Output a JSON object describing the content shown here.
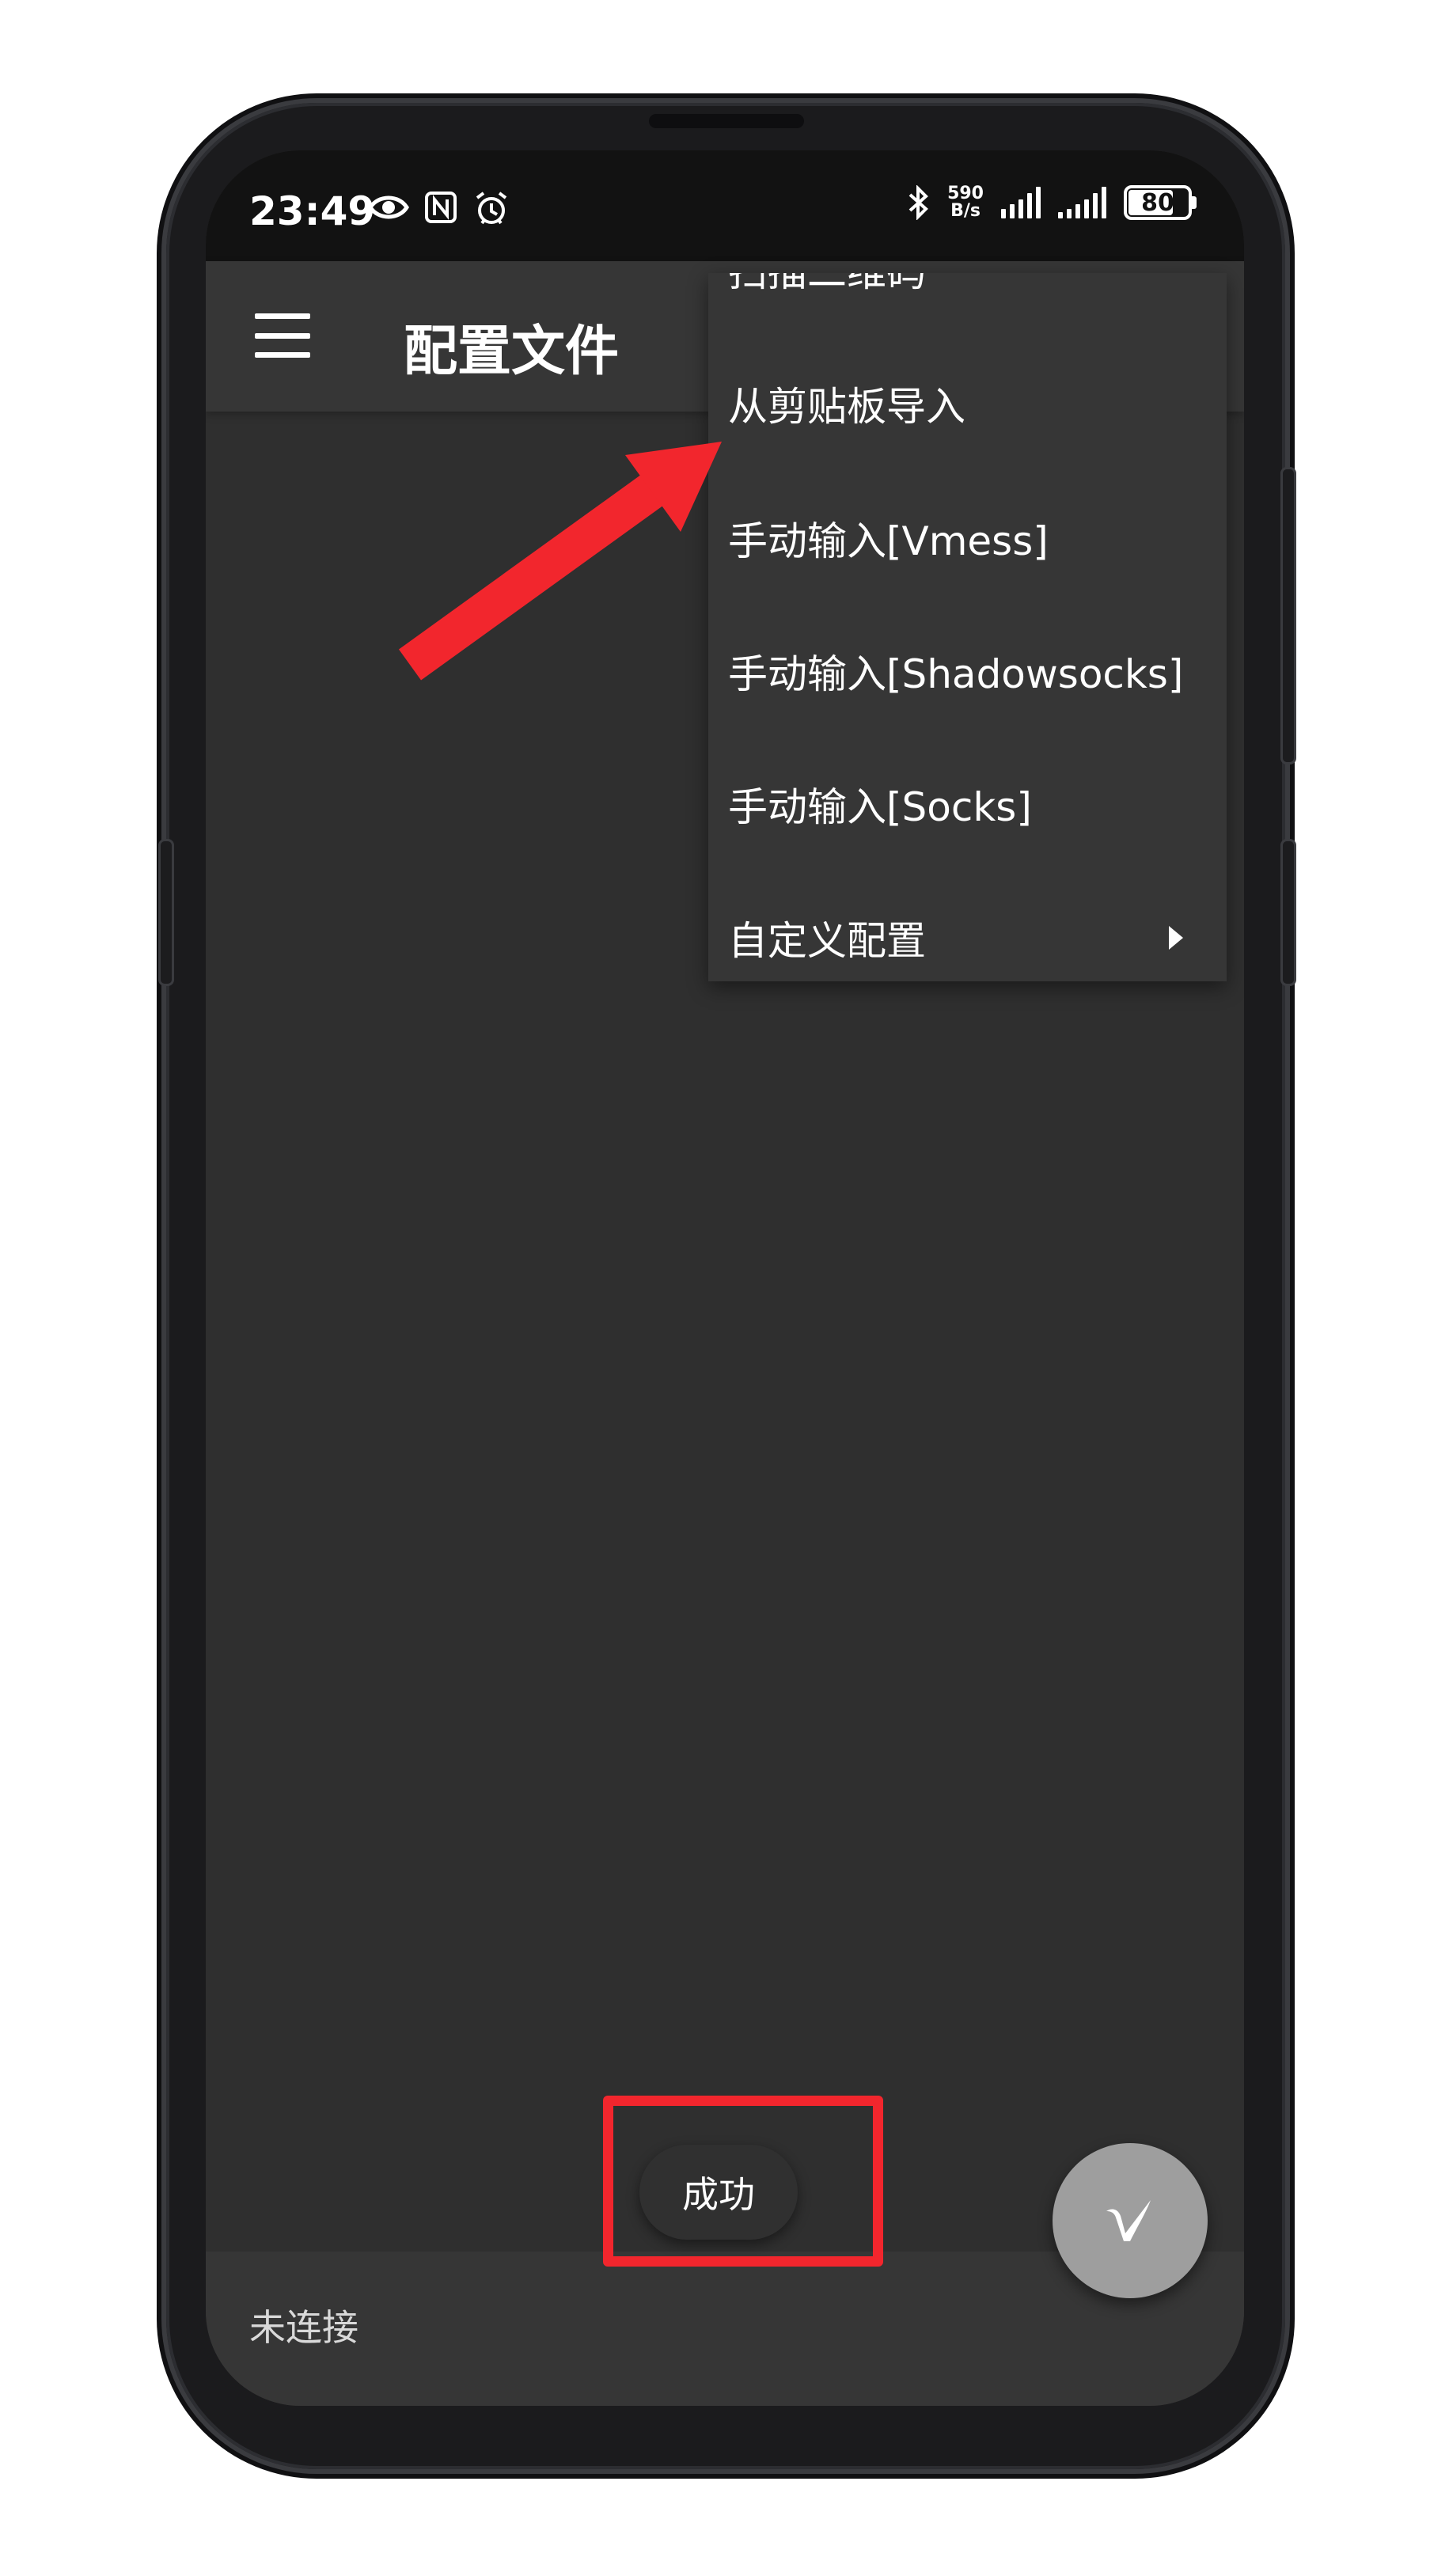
{
  "status_bar": {
    "time": "23:49",
    "net_speed_value": "590",
    "net_speed_unit": "B/s",
    "battery_level": "80",
    "battery_fraction": 0.8
  },
  "toolbar": {
    "title": "配置文件"
  },
  "menu": {
    "items": [
      {
        "label": "扫描二维码"
      },
      {
        "label": "从剪贴板导入"
      },
      {
        "label": "手动输入[Vmess]"
      },
      {
        "label": "手动输入[Shadowsocks]"
      },
      {
        "label": "手动输入[Socks]"
      },
      {
        "label": "自定义配置",
        "has_submenu": true
      }
    ]
  },
  "toast": {
    "message": "成功"
  },
  "bottom_bar": {
    "connection_status": "未连接"
  },
  "fab": {
    "icon": "v2ray-logo-icon"
  },
  "colors": {
    "background": "#2f2f2f",
    "toolbar": "#363636",
    "annotation_red": "#f2262d",
    "fab": "#9e9e9e"
  }
}
